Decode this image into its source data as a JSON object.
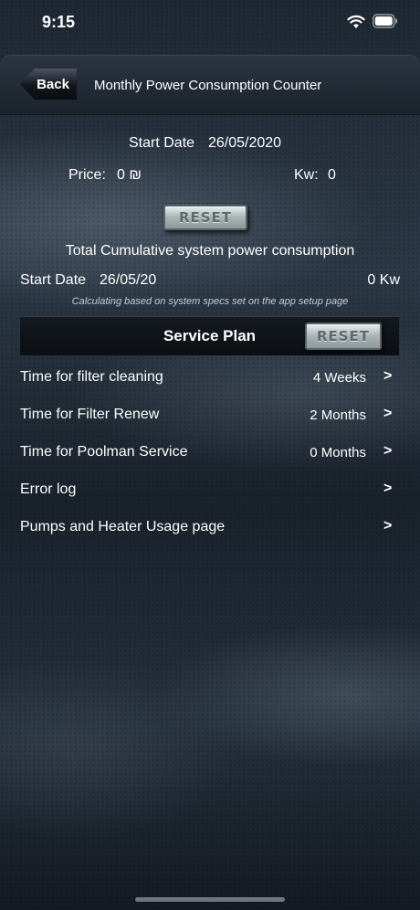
{
  "status_bar": {
    "time": "9:15",
    "icons": [
      "wifi-icon",
      "battery-icon"
    ]
  },
  "nav": {
    "back_label": "Back",
    "title": "Monthly Power Consumption Counter"
  },
  "monthly": {
    "start_date_label": "Start Date",
    "start_date_value": "26/05/2020",
    "price_label": "Price:",
    "price_value": "0 ₪",
    "kw_label": "Kw:",
    "kw_value": "0",
    "reset_label": "RESET"
  },
  "cumulative": {
    "title": "Total Cumulative system power consumption",
    "start_date_label": "Start Date",
    "start_date_value": "26/05/20",
    "total_value": "0 Kw",
    "note": "Calculating based on system specs set on the app setup page"
  },
  "service_plan": {
    "title": "Service Plan",
    "reset_label": "RESET",
    "rows": [
      {
        "label": "Time for filter cleaning",
        "value": "4 Weeks",
        "chevron": ">"
      },
      {
        "label": "Time for Filter Renew",
        "value": "2 Months",
        "chevron": ">"
      },
      {
        "label": "Time for Poolman Service",
        "value": "0 Months",
        "chevron": ">"
      },
      {
        "label": "Error log",
        "value": "",
        "chevron": ">"
      },
      {
        "label": "Pumps and Heater Usage page",
        "value": "",
        "chevron": ">"
      }
    ]
  }
}
